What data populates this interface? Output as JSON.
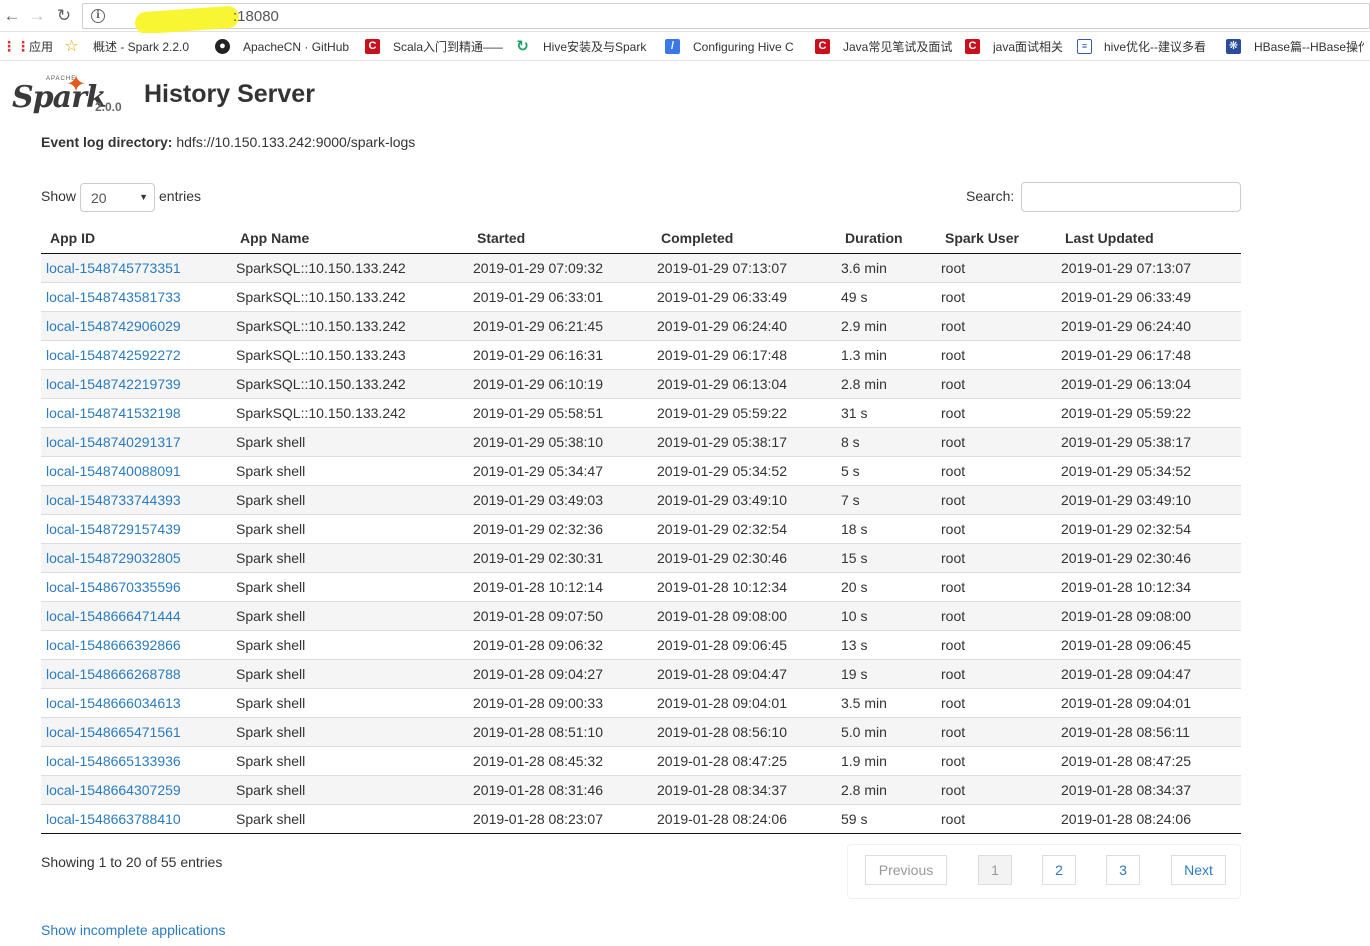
{
  "browser": {
    "url_visible_suffix": ":18080",
    "bookmarks": [
      {
        "label": "应用",
        "icon": "apps-grid-icon"
      },
      {
        "label": "概述 - Spark 2.2.0 ",
        "icon": "star-icon"
      },
      {
        "label": "ApacheCN · GitHub",
        "icon": "github-icon"
      },
      {
        "label": "Scala入门到精通——",
        "icon": "csdn-icon"
      },
      {
        "label": "Hive安装及与Spark",
        "icon": "refresh-green-icon"
      },
      {
        "label": "Configuring Hive C",
        "icon": "pen-blue-icon"
      },
      {
        "label": "Java常见笔试及面试",
        "icon": "csdn-icon"
      },
      {
        "label": "java面试相关",
        "icon": "csdn-icon"
      },
      {
        "label": "hive优化--建议多看",
        "icon": "doc-icon"
      },
      {
        "label": "HBase篇--HBase操作",
        "icon": "globe-icon"
      }
    ]
  },
  "header": {
    "logo_apache": "APACHE",
    "logo_text": "Spark",
    "version": "2.0.0",
    "title": "History Server"
  },
  "event_log": {
    "label": "Event log directory:",
    "value": "hdfs://10.150.133.242:9000/spark-logs"
  },
  "controls": {
    "show_label": "Show",
    "entries_value": "20",
    "entries_label": "entries",
    "search_label": "Search:",
    "search_value": ""
  },
  "table": {
    "columns": [
      "App ID",
      "App Name",
      "Started",
      "Completed",
      "Duration",
      "Spark User",
      "Last Updated"
    ],
    "rows": [
      [
        "local-1548745773351",
        "SparkSQL::10.150.133.242",
        "2019-01-29 07:09:32",
        "2019-01-29 07:13:07",
        "3.6 min",
        "root",
        "2019-01-29 07:13:07"
      ],
      [
        "local-1548743581733",
        "SparkSQL::10.150.133.242",
        "2019-01-29 06:33:01",
        "2019-01-29 06:33:49",
        "49 s",
        "root",
        "2019-01-29 06:33:49"
      ],
      [
        "local-1548742906029",
        "SparkSQL::10.150.133.242",
        "2019-01-29 06:21:45",
        "2019-01-29 06:24:40",
        "2.9 min",
        "root",
        "2019-01-29 06:24:40"
      ],
      [
        "local-1548742592272",
        "SparkSQL::10.150.133.243",
        "2019-01-29 06:16:31",
        "2019-01-29 06:17:48",
        "1.3 min",
        "root",
        "2019-01-29 06:17:48"
      ],
      [
        "local-1548742219739",
        "SparkSQL::10.150.133.242",
        "2019-01-29 06:10:19",
        "2019-01-29 06:13:04",
        "2.8 min",
        "root",
        "2019-01-29 06:13:04"
      ],
      [
        "local-1548741532198",
        "SparkSQL::10.150.133.242",
        "2019-01-29 05:58:51",
        "2019-01-29 05:59:22",
        "31 s",
        "root",
        "2019-01-29 05:59:22"
      ],
      [
        "local-1548740291317",
        "Spark shell",
        "2019-01-29 05:38:10",
        "2019-01-29 05:38:17",
        "8 s",
        "root",
        "2019-01-29 05:38:17"
      ],
      [
        "local-1548740088091",
        "Spark shell",
        "2019-01-29 05:34:47",
        "2019-01-29 05:34:52",
        "5 s",
        "root",
        "2019-01-29 05:34:52"
      ],
      [
        "local-1548733744393",
        "Spark shell",
        "2019-01-29 03:49:03",
        "2019-01-29 03:49:10",
        "7 s",
        "root",
        "2019-01-29 03:49:10"
      ],
      [
        "local-1548729157439",
        "Spark shell",
        "2019-01-29 02:32:36",
        "2019-01-29 02:32:54",
        "18 s",
        "root",
        "2019-01-29 02:32:54"
      ],
      [
        "local-1548729032805",
        "Spark shell",
        "2019-01-29 02:30:31",
        "2019-01-29 02:30:46",
        "15 s",
        "root",
        "2019-01-29 02:30:46"
      ],
      [
        "local-1548670335596",
        "Spark shell",
        "2019-01-28 10:12:14",
        "2019-01-28 10:12:34",
        "20 s",
        "root",
        "2019-01-28 10:12:34"
      ],
      [
        "local-1548666471444",
        "Spark shell",
        "2019-01-28 09:07:50",
        "2019-01-28 09:08:00",
        "10 s",
        "root",
        "2019-01-28 09:08:00"
      ],
      [
        "local-1548666392866",
        "Spark shell",
        "2019-01-28 09:06:32",
        "2019-01-28 09:06:45",
        "13 s",
        "root",
        "2019-01-28 09:06:45"
      ],
      [
        "local-1548666268788",
        "Spark shell",
        "2019-01-28 09:04:27",
        "2019-01-28 09:04:47",
        "19 s",
        "root",
        "2019-01-28 09:04:47"
      ],
      [
        "local-1548666034613",
        "Spark shell",
        "2019-01-28 09:00:33",
        "2019-01-28 09:04:01",
        "3.5 min",
        "root",
        "2019-01-28 09:04:01"
      ],
      [
        "local-1548665471561",
        "Spark shell",
        "2019-01-28 08:51:10",
        "2019-01-28 08:56:10",
        "5.0 min",
        "root",
        "2019-01-28 08:56:11"
      ],
      [
        "local-1548665133936",
        "Spark shell",
        "2019-01-28 08:45:32",
        "2019-01-28 08:47:25",
        "1.9 min",
        "root",
        "2019-01-28 08:47:25"
      ],
      [
        "local-1548664307259",
        "Spark shell",
        "2019-01-28 08:31:46",
        "2019-01-28 08:34:37",
        "2.8 min",
        "root",
        "2019-01-28 08:34:37"
      ],
      [
        "local-1548663788410",
        "Spark shell",
        "2019-01-28 08:23:07",
        "2019-01-28 08:24:06",
        "59 s",
        "root",
        "2019-01-28 08:24:06"
      ]
    ]
  },
  "footer": {
    "showing": "Showing 1 to 20 of 55 entries",
    "previous": "Previous",
    "pages": [
      "1",
      "2",
      "3"
    ],
    "active_page": "1",
    "next": "Next",
    "incomplete_link": "Show incomplete applications"
  },
  "colors": {
    "link": "#2a7bc0",
    "spark_orange": "#e25a1c",
    "row_stripe": "#f5f5f5"
  }
}
